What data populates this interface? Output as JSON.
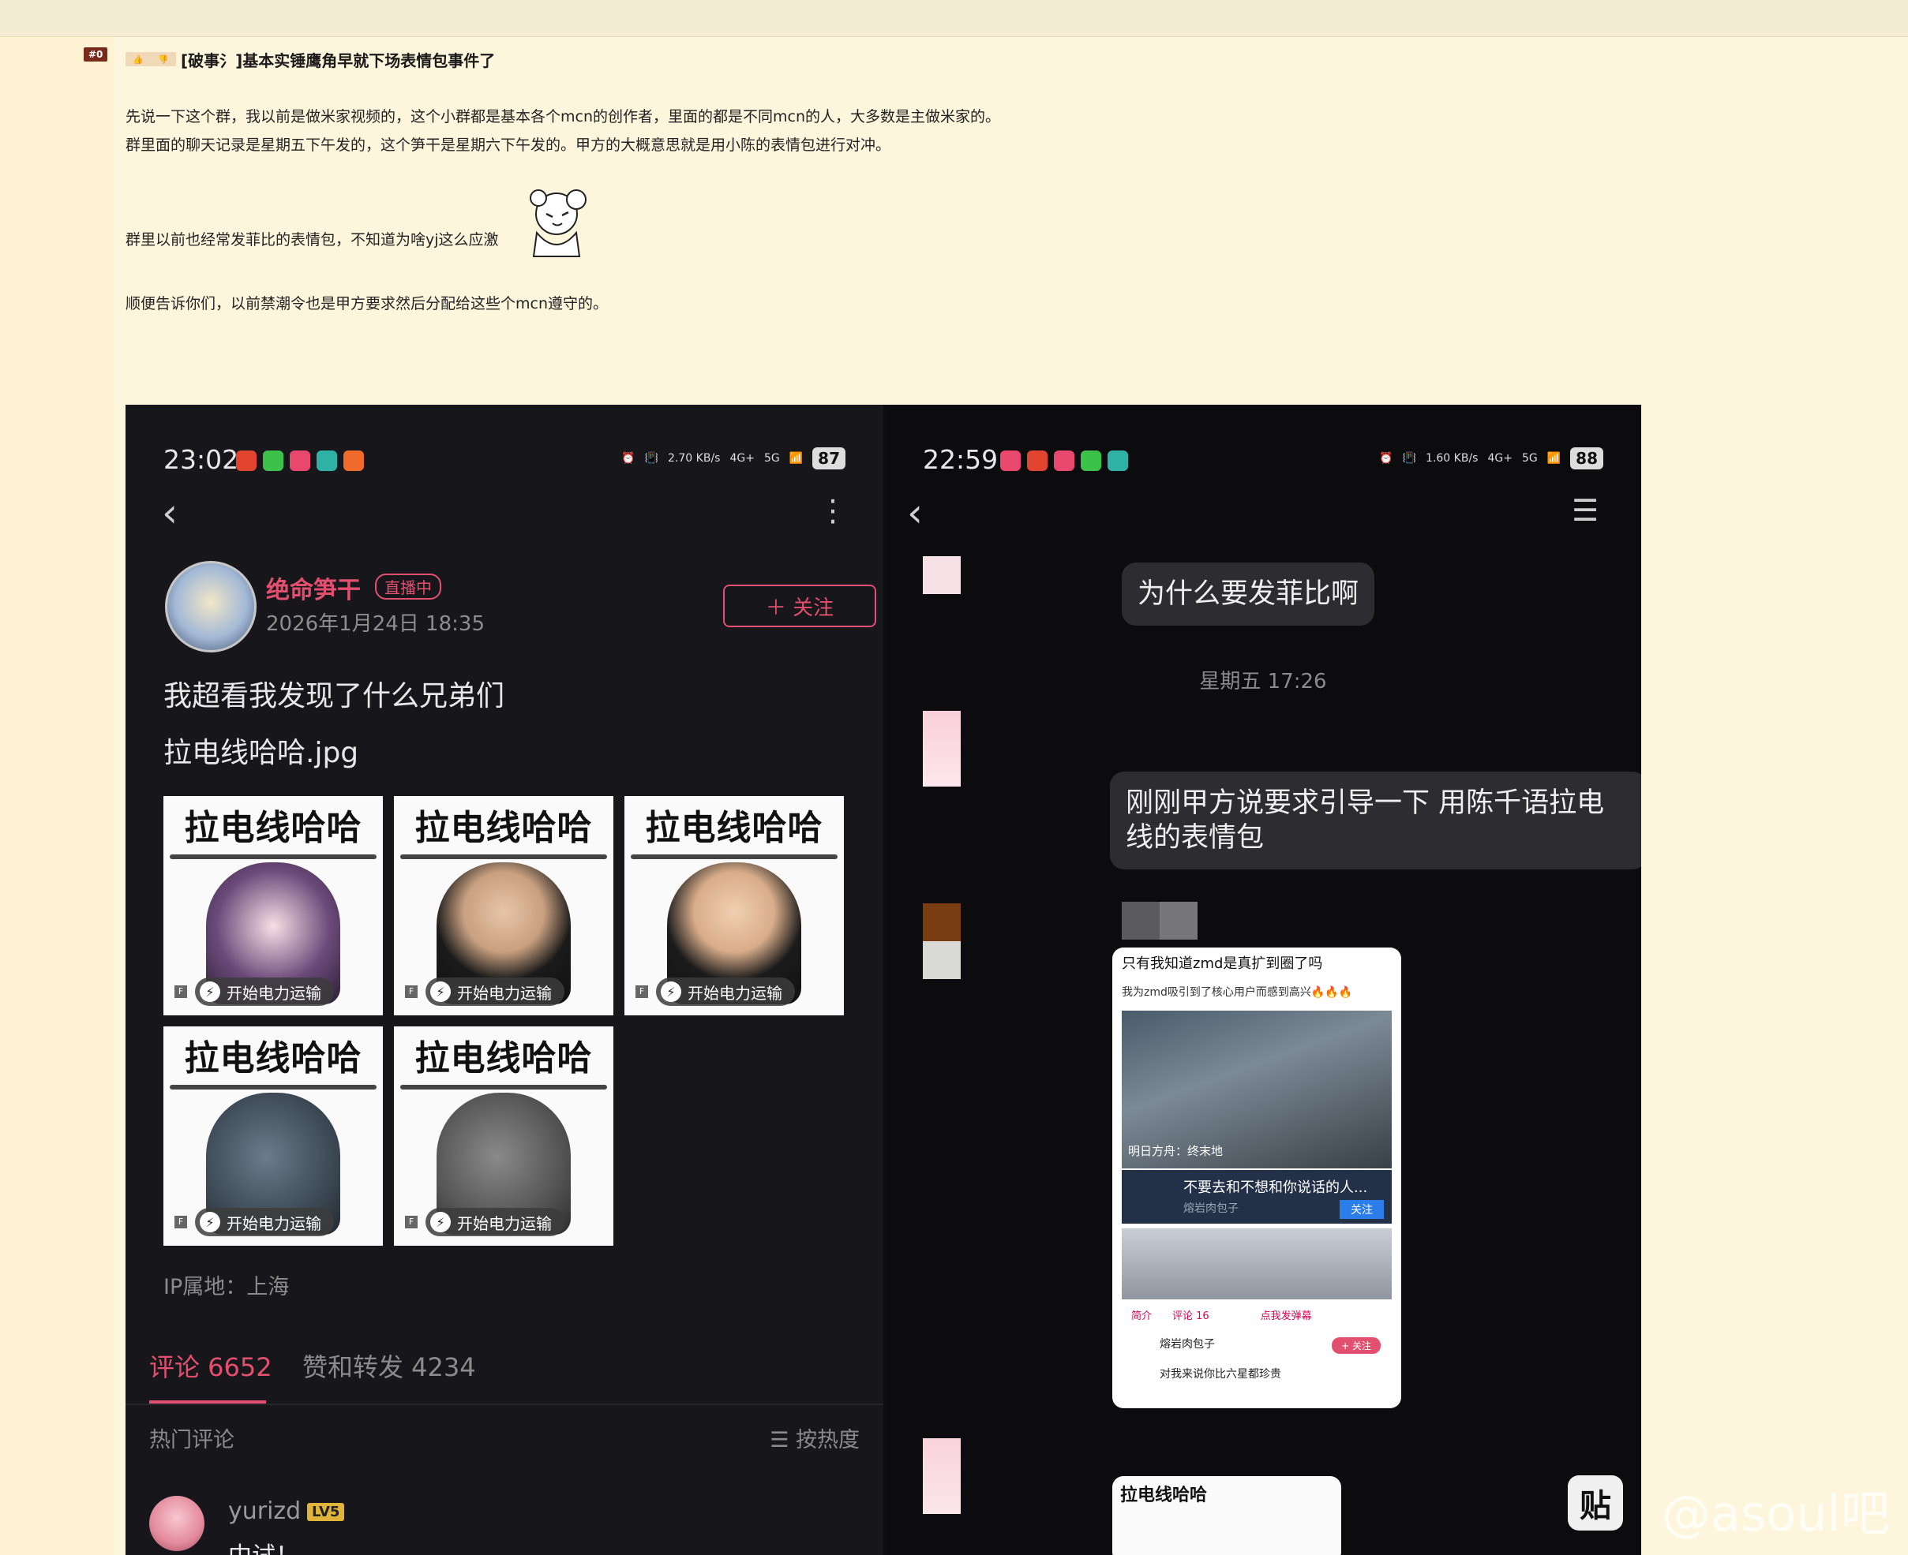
{
  "post": {
    "floor": "#0",
    "title": "[破事氵]基本实锤鹰角早就下场表情包事件了",
    "paragraphs": [
      "先说一下这个群，我以前是做米家视频的，这个小群都是基本各个mcn的创作者，里面的都是不同mcn的人，大多数是主做米家的。",
      "群里面的聊天记录是星期五下午发的，这个笋干是星期六下午发的。甲方的大概意思就是用小陈的表情包进行对冲。",
      "群里以前也经常发菲比的表情包，不知道为啥yj这么应激",
      "顺便告诉你们，以前禁潮令也是甲方要求然后分配给这些个mcn遵守的。"
    ]
  },
  "left_phone": {
    "time": "23:02",
    "speed": "2.70",
    "speed_unit": "KB/s",
    "net1": "4G+",
    "net2": "5G",
    "battery": "87",
    "back_icon": "chevron-left-icon",
    "more_icon": "more-vertical-icon",
    "user_name": "绝命笋干",
    "live_tag": "直播中",
    "date": "2026年1月24日 18:35",
    "follow": "＋ 关注",
    "text_line1": "我超看我发现了什么兄弟们",
    "text_line2": "拉电线哈哈.jpg",
    "stickers": [
      {
        "title": "拉电线哈哈",
        "chip": "开始电力运输",
        "badge": "F"
      },
      {
        "title": "拉电线哈哈",
        "chip": "开始电力运输",
        "badge": "F"
      },
      {
        "title": "拉电线哈哈",
        "chip": "开始电力运输",
        "badge": "F"
      },
      {
        "title": "拉电线哈哈",
        "chip": "开始电力运输",
        "badge": "F"
      },
      {
        "title": "拉电线哈哈",
        "chip": "开始电力运输",
        "badge": "F"
      }
    ],
    "ip": "IP属地：上海",
    "tab_comments": "评论 6652",
    "tab_likes": "赞和转发 4234",
    "hot_label": "热门评论",
    "sort_label": "☰ 按热度",
    "comment_user": "yurizd",
    "comment_level": "LV5",
    "comment_text": "中试！"
  },
  "right_phone": {
    "time": "22:59",
    "speed": "1.60",
    "speed_unit": "KB/s",
    "net1": "4G+",
    "net2": "5G",
    "battery": "88",
    "menu_icon": "hamburger-menu-icon",
    "msg1": "为什么要发菲比啊",
    "day_stamp": "星期五 17:26",
    "msg2_line1": "刚刚甲方说要求引导一下 用陈千语拉电",
    "msg2_line2": "线的表情包",
    "img_line1": "只有我知道zmd是真扩到圈了吗",
    "img_line2": "我为zmd吸引到了核心用户而感到高兴🔥🔥🔥",
    "img_caption": "明日方舟：终末地",
    "img_card_title": "不要去和不想和你说话的人...",
    "img_card_sub": "熔岩肉包子",
    "img_card_follow": "关注",
    "img_tabs": "简介　　评论 16　　　　　点我发弹幕",
    "img_author": "熔岩肉包子",
    "img_author_follow": "+ 关注",
    "img_video_title": "对我来说你比六星都珍贵",
    "sticker_peek_title": "拉电线哈哈"
  },
  "watermark": {
    "icon": "贴",
    "text": "@asoul吧"
  },
  "colors": {
    "accent": "#e24f6f",
    "page_bg": "#fef6dc",
    "dark_bg": "#17171b"
  }
}
